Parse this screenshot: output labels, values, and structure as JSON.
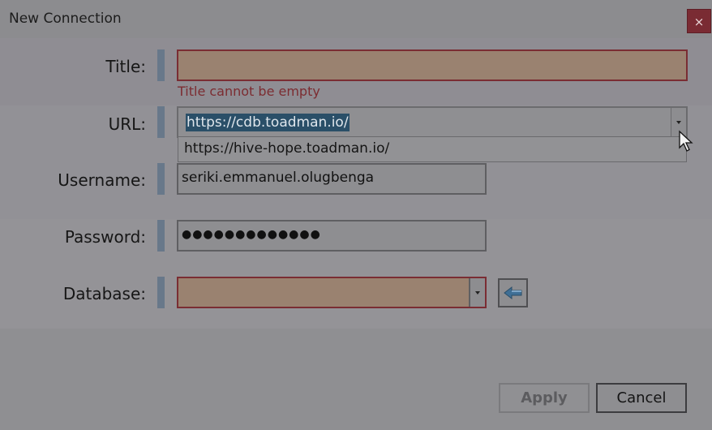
{
  "window": {
    "title": "New Connection",
    "close_label": "×"
  },
  "form": {
    "title": {
      "label": "Title:",
      "value": "",
      "error": "Title cannot be empty"
    },
    "url": {
      "label": "URL:",
      "value": "https://cdb.toadman.io/",
      "options": [
        "https://hive-hope.toadman.io/"
      ]
    },
    "username": {
      "label": "Username:",
      "value": "seriki.emmanuel.olugbenga"
    },
    "password": {
      "label": "Password:",
      "value": "●●●●●●●●●●●●●"
    },
    "database": {
      "label": "Database:",
      "value": ""
    }
  },
  "buttons": {
    "apply": "Apply",
    "cancel": "Cancel"
  },
  "icons": {
    "refresh": "back-arrow-icon",
    "close": "close-icon",
    "dropdown": "chevron-down-icon",
    "cursor": "mouse-cursor-icon"
  },
  "colors": {
    "error": "#7c2c31",
    "accent_bar": "#68788a",
    "invalid_fill": "#9a8270",
    "selection": "#2a4f68"
  }
}
